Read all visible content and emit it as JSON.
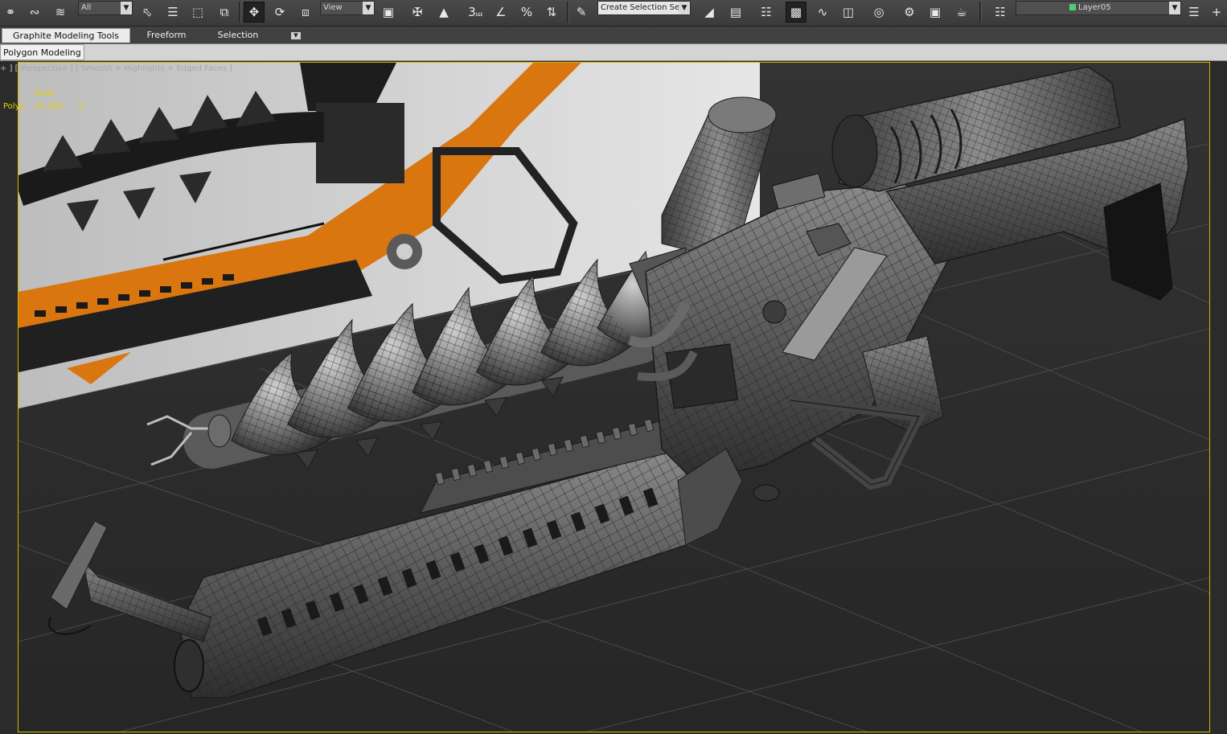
{
  "toolbar": {
    "selection_filter": "All",
    "ref_coord_system": "View",
    "named_selection_set": "Create Selection Se",
    "snap_angle_label": "3",
    "current_layer": "Layer05",
    "icons": [
      "undo-link-icon",
      "unlink-icon",
      "bind-spacewarp-icon",
      "select-object-icon",
      "select-by-name-icon",
      "rect-region-icon",
      "window-crossing-icon",
      "select-move-icon",
      "select-rotate-icon",
      "select-scale-icon",
      "pick-ref-icon",
      "pivot-icon",
      "manipulate-icon",
      "keyboard-shortcut-icon",
      "snaps-toggle-icon",
      "angle-snap-icon",
      "percent-snap-icon",
      "spinner-snap-icon",
      "edit-named-sets-icon",
      "mirror-icon",
      "align-icon",
      "layer-manager-icon",
      "toggle-ribbon-icon",
      "curve-editor-icon",
      "schematic-view-icon",
      "material-editor-icon",
      "render-setup-icon",
      "rendered-frame-icon",
      "render-icon"
    ],
    "accent_color": "#d2b400"
  },
  "ribbon": {
    "tabs": [
      "Graphite Modeling Tools",
      "Freeform",
      "Selection"
    ],
    "active_tab": "Graphite Modeling Tools",
    "panel_tab": "Polygon Modeling"
  },
  "viewport": {
    "label_plus": "+",
    "label_view": "Perspective",
    "label_shading": "Smooth + Highlights + Edged Faces",
    "stats_header": "Total",
    "polys_label": "Polys:",
    "polys_total": "21,280",
    "polys_selected": "0",
    "border_color": "#d2b400"
  }
}
